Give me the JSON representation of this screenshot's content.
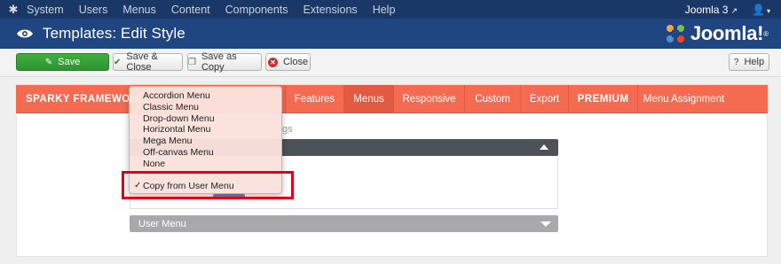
{
  "topnav": {
    "items": [
      "System",
      "Users",
      "Menus",
      "Content",
      "Components",
      "Extensions",
      "Help"
    ],
    "site_link": "Joomla 3"
  },
  "titlebar": {
    "title": "Templates: Edit Style",
    "brand": "Joomla!",
    "brand_mark": "®"
  },
  "toolbar": {
    "save": "Save",
    "save_close": "Save & Close",
    "save_copy": "Save as Copy",
    "close": "Close",
    "help": "Help"
  },
  "tabs": [
    {
      "label": "SPARKY FRAMEWORK",
      "bold": true,
      "active": false
    },
    {
      "label": "Features",
      "bold": false,
      "active": false
    },
    {
      "label": "Menus",
      "bold": false,
      "active": true
    },
    {
      "label": "Responsive",
      "bold": false,
      "active": false
    },
    {
      "label": "Custom",
      "bold": false,
      "active": false
    },
    {
      "label": "Export",
      "bold": false,
      "active": false
    },
    {
      "label": "PREMIUM",
      "bold": true,
      "active": false
    },
    {
      "label": "Menu Assignment",
      "bold": false,
      "active": false
    }
  ],
  "dropdown": {
    "options": [
      "Accordion Menu",
      "Classic Menu",
      "Drop-down Menu",
      "Horizontal Menu",
      "Mega Menu",
      "Off-canvas Menu",
      "None"
    ],
    "separator": "-----------------------------------------------",
    "selected": "Copy from User Menu"
  },
  "panel": {
    "hint": "gs",
    "footer_label": "User Menu"
  },
  "colors": {
    "nav": "#1a3867",
    "titlebar": "#1f4680",
    "tabbar": "#f46b51",
    "active_tab": "#e35a42",
    "save": "#3fae3f",
    "highlight": "#e4001b"
  }
}
